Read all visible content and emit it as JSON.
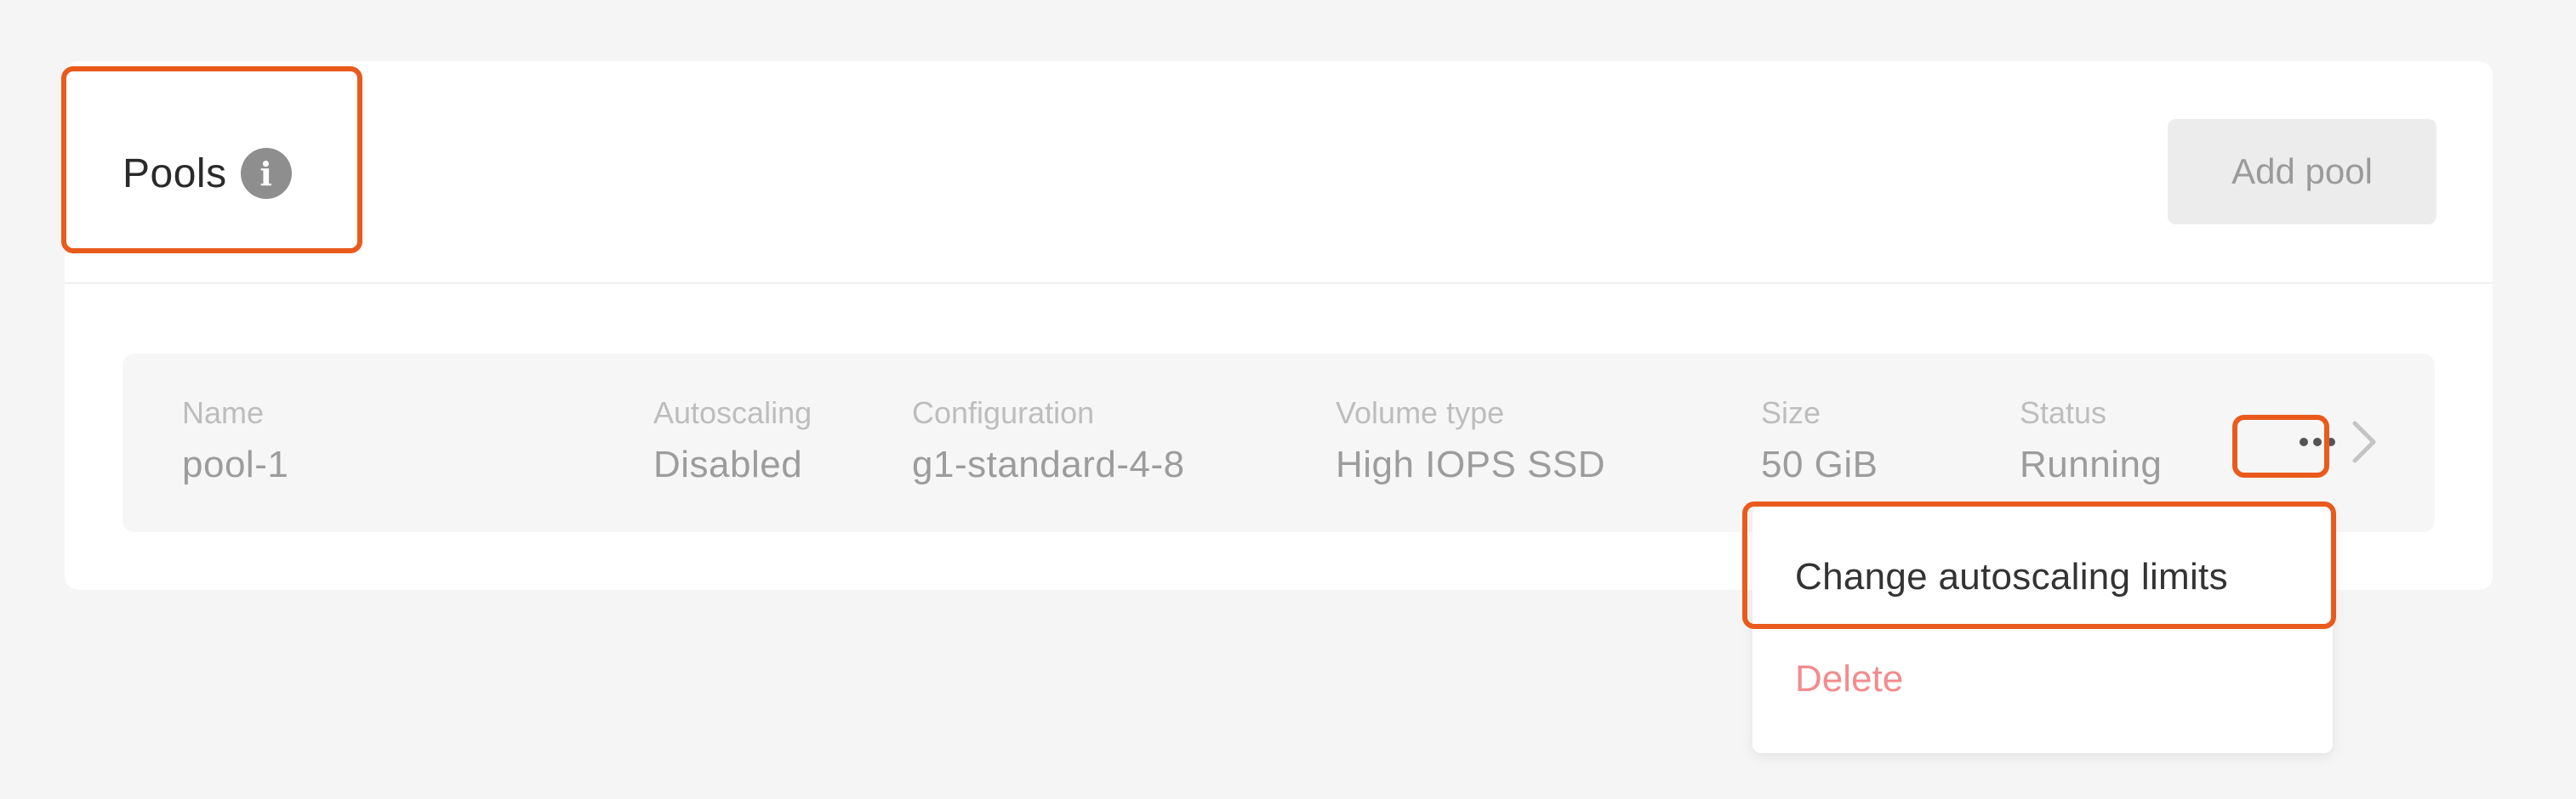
{
  "header": {
    "title": "Pools",
    "add_pool_label": "Add pool"
  },
  "pool": {
    "columns": [
      {
        "label": "Name",
        "value": "pool-1"
      },
      {
        "label": "Autoscaling",
        "value": "Disabled"
      },
      {
        "label": "Configuration",
        "value": "g1-standard-4-8"
      },
      {
        "label": "Volume type",
        "value": "High IOPS SSD"
      },
      {
        "label": "Size",
        "value": "50 GiB"
      },
      {
        "label": "Status",
        "value": "Running"
      }
    ]
  },
  "menu": {
    "items": [
      {
        "label": "Change autoscaling limits"
      },
      {
        "label": "Delete"
      }
    ]
  },
  "icons": {
    "info": "info-icon",
    "more": "more-horizontal-icon",
    "chevron": "chevron-right-icon"
  },
  "colors": {
    "highlight": "#ea5a1c",
    "delete": "#f28c8c",
    "background": "#f5f5f5"
  }
}
